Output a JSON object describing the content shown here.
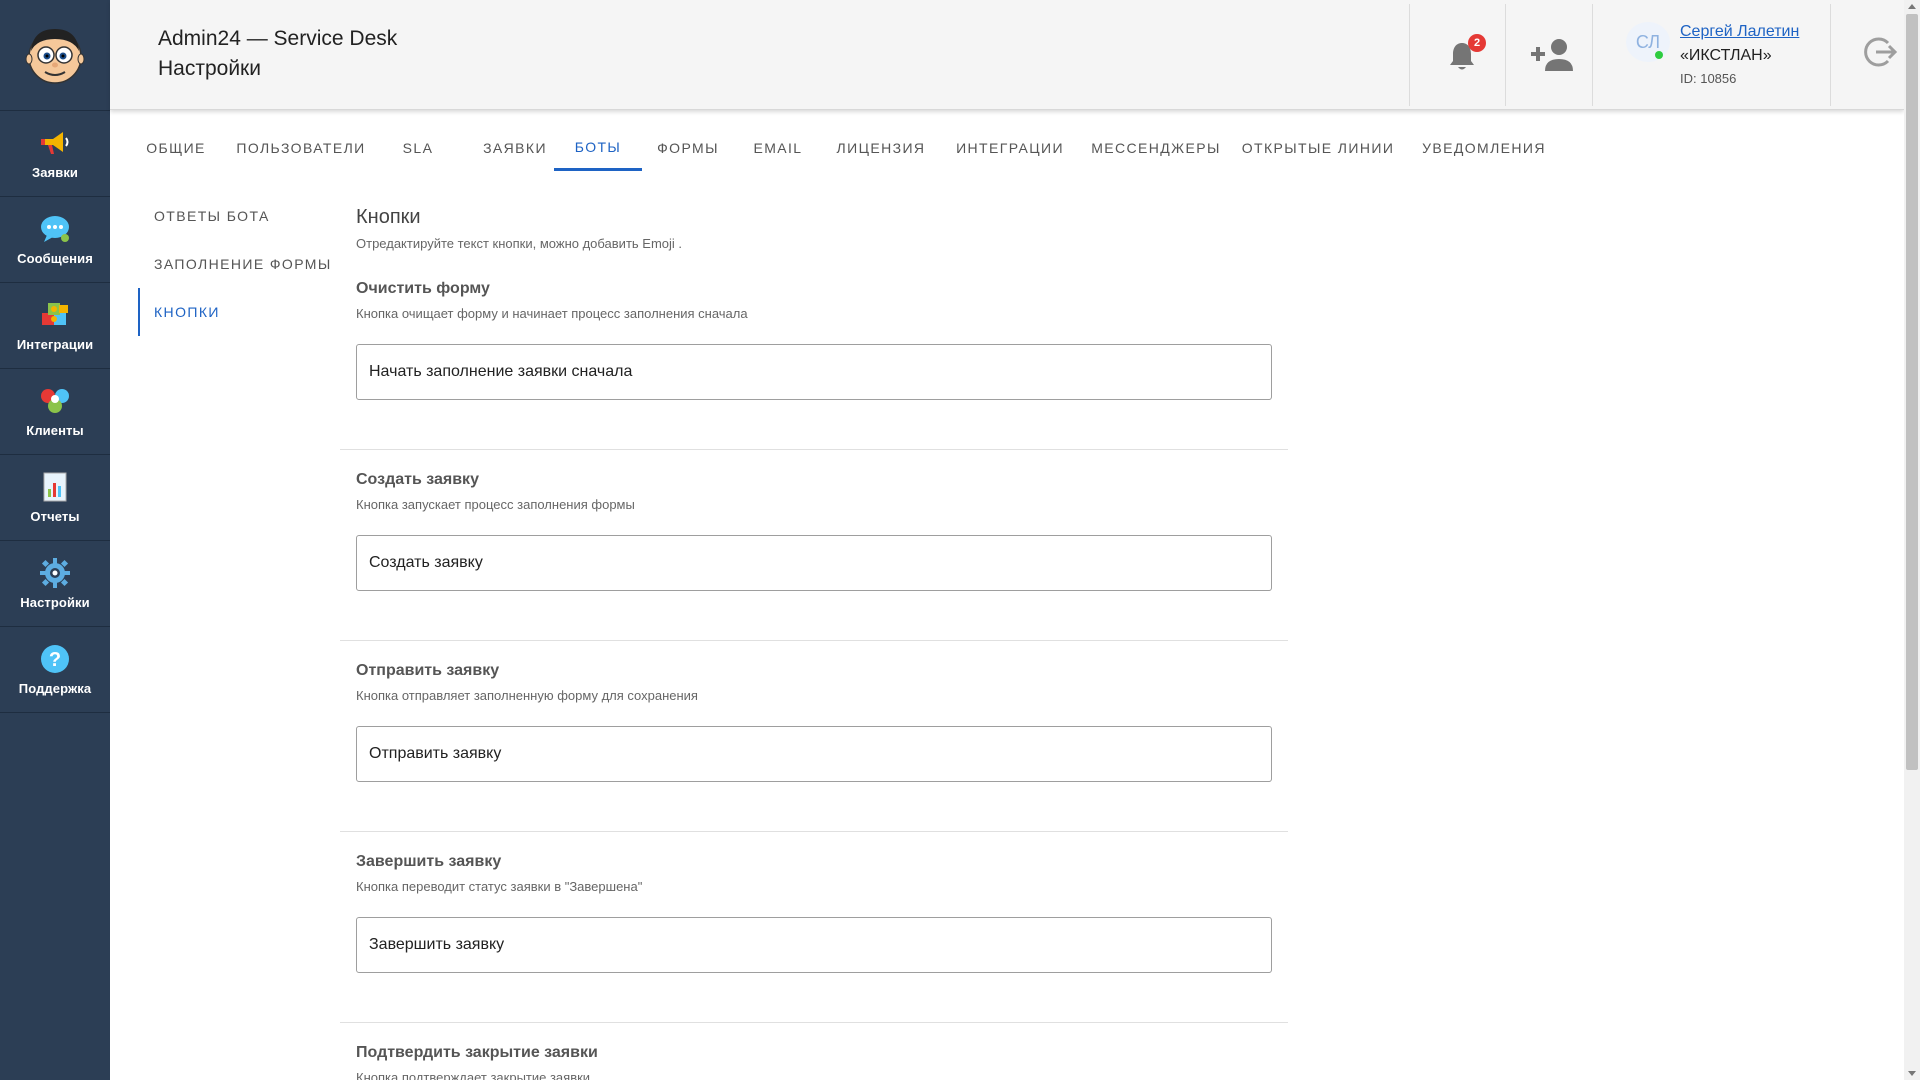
{
  "header": {
    "app_title": "Admin24 — Service Desk",
    "page_title": "Настройки",
    "notifications_count": "2",
    "user": {
      "initials": "СЛ",
      "name": "Сергей Лалетин",
      "org": "«ИКСТЛАН»",
      "id": "ID: 10856"
    }
  },
  "sidebar": {
    "items": [
      {
        "label": "Заявки",
        "icon": "megaphone-icon"
      },
      {
        "label": "Сообщения",
        "icon": "chat-icon"
      },
      {
        "label": "Интеграции",
        "icon": "puzzle-icon"
      },
      {
        "label": "Клиенты",
        "icon": "clients-icon"
      },
      {
        "label": "Отчеты",
        "icon": "report-icon"
      },
      {
        "label": "Настройки",
        "icon": "gear-icon"
      },
      {
        "label": "Поддержка",
        "icon": "help-icon"
      }
    ]
  },
  "tabs": [
    "ОБЩИЕ",
    "ПОЛЬЗОВАТЕЛИ",
    "SLA",
    "ЗАЯВКИ",
    "БОТЫ",
    "ФОРМЫ",
    "EMAIL",
    "ЛИЦЕНЗИЯ",
    "ИНТЕГРАЦИИ",
    "МЕССЕНДЖЕРЫ",
    "ОТКРЫТЫЕ ЛИНИИ",
    "УВЕДОМЛЕНИЯ"
  ],
  "active_tab": "БОТЫ",
  "subnav": [
    "ОТВЕТЫ БОТА",
    "ЗАПОЛНЕНИЕ ФОРМЫ",
    "КНОПКИ"
  ],
  "active_subnav": "КНОПКИ",
  "section": {
    "title": "Кнопки",
    "description": "Отредактируйте текст кнопки, можно добавить Emoji ."
  },
  "fields": [
    {
      "title": "Очистить форму",
      "description": "Кнопка очищает форму и начинает процесс заполнения сначала",
      "value": "Начать заполнение заявки сначала"
    },
    {
      "title": "Создать заявку",
      "description": "Кнопка запускает процесс заполнения формы",
      "value": "Создать заявку"
    },
    {
      "title": "Отправить заявку",
      "description": "Кнопка отправляет заполненную форму для сохранения",
      "value": "Отправить заявку"
    },
    {
      "title": "Завершить заявку",
      "description": "Кнопка переводит статус заявки в \"Завершена\"",
      "value": "Завершить заявку"
    },
    {
      "title": "Подтвердить закрытие заявки",
      "description": "Кнопка подтверждает закрытие заявки",
      "value": ""
    }
  ],
  "colors": {
    "sidebar_bg": "#2c3e55",
    "accent": "#1e63c4",
    "badge": "#e53935",
    "online": "#2ecc40"
  }
}
